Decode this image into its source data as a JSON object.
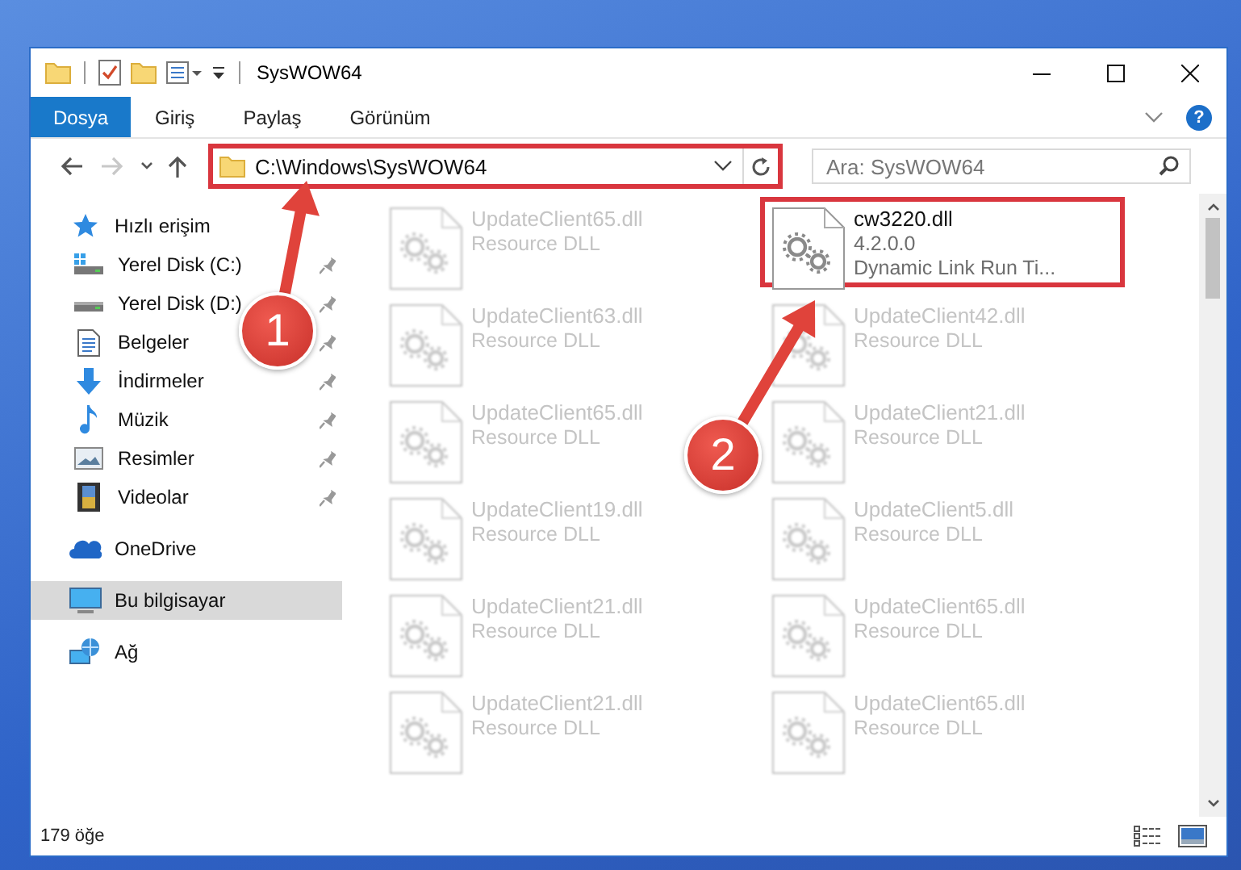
{
  "window": {
    "title": "SysWOW64"
  },
  "ribbon_tabs": [
    {
      "label": "Dosya",
      "selected": true
    },
    {
      "label": "Giriş",
      "selected": false
    },
    {
      "label": "Paylaş",
      "selected": false
    },
    {
      "label": "Görünüm",
      "selected": false
    }
  ],
  "help_button": {
    "label": "?"
  },
  "navigation": {
    "forward_disabled": true
  },
  "address": {
    "path": "C:\\Windows\\SysWOW64",
    "highlighted": true
  },
  "search": {
    "placeholder": "Ara: SysWOW64"
  },
  "sidebar": {
    "items": [
      {
        "label": "Hızlı erişim",
        "kind": "star",
        "selected": false,
        "children": [
          {
            "label": "Yerel Disk (C:)",
            "kind": "system-drive",
            "pinned": true,
            "selected": false
          },
          {
            "label": "Yerel Disk (D:)",
            "kind": "drive",
            "pinned": true,
            "selected": false
          },
          {
            "label": "Belgeler",
            "kind": "documents",
            "pinned": true,
            "selected": false
          },
          {
            "label": "İndirmeler",
            "kind": "downloads",
            "pinned": true,
            "selected": false
          },
          {
            "label": "Müzik",
            "kind": "music",
            "pinned": true,
            "selected": false
          },
          {
            "label": "Resimler",
            "kind": "pictures",
            "pinned": true,
            "selected": false
          },
          {
            "label": "Videolar",
            "kind": "videos",
            "pinned": true,
            "selected": false
          }
        ]
      },
      {
        "label": "OneDrive",
        "kind": "cloud",
        "selected": false
      },
      {
        "label": "Bu bilgisayar",
        "kind": "computer",
        "selected": true
      },
      {
        "label": "Ağ",
        "kind": "network",
        "selected": false
      }
    ]
  },
  "files": [
    {
      "name": "UpdateClient65.dll",
      "details": [
        "Resource DLL"
      ],
      "blurred": true,
      "highlighted": false
    },
    {
      "name": "cw3220.dll",
      "details": [
        "4.2.0.0",
        "Dynamic Link Run Ti..."
      ],
      "blurred": false,
      "highlighted": true
    },
    {
      "name": "UpdateClient63.dll",
      "details": [
        "Resource DLL"
      ],
      "blurred": true,
      "highlighted": false
    },
    {
      "name": "UpdateClient42.dll",
      "details": [
        "Resource DLL"
      ],
      "blurred": true,
      "highlighted": false
    },
    {
      "name": "UpdateClient65.dll",
      "details": [
        "Resource DLL"
      ],
      "blurred": true,
      "highlighted": false
    },
    {
      "name": "UpdateClient21.dll",
      "details": [
        "Resource DLL"
      ],
      "blurred": true,
      "highlighted": false
    },
    {
      "name": "UpdateClient19.dll",
      "details": [
        "Resource DLL"
      ],
      "blurred": true,
      "highlighted": false
    },
    {
      "name": "UpdateClient5.dll",
      "details": [
        "Resource DLL"
      ],
      "blurred": true,
      "highlighted": false
    },
    {
      "name": "UpdateClient21.dll",
      "details": [
        "Resource DLL"
      ],
      "blurred": true,
      "highlighted": false
    },
    {
      "name": "UpdateClient65.dll",
      "details": [
        "Resource DLL"
      ],
      "blurred": true,
      "highlighted": false
    },
    {
      "name": "UpdateClient21.dll",
      "details": [
        "Resource DLL"
      ],
      "blurred": true,
      "highlighted": false
    },
    {
      "name": "UpdateClient65.dll",
      "details": [
        "Resource DLL"
      ],
      "blurred": true,
      "highlighted": false
    }
  ],
  "status_bar": {
    "count": "179 öğe"
  },
  "annotations": [
    {
      "number": "1"
    },
    {
      "number": "2"
    }
  ]
}
